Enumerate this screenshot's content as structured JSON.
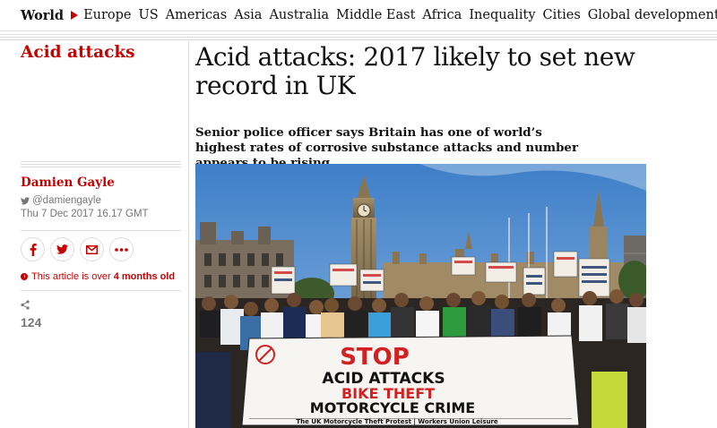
{
  "nav": {
    "active": "World",
    "items": [
      "Europe",
      "US",
      "Americas",
      "Asia",
      "Australia",
      "Middle East",
      "Africa",
      "Inequality",
      "Cities",
      "Global development"
    ]
  },
  "article": {
    "section_label": "Acid attacks",
    "headline": "Acid attacks: 2017 likely to set new record in UK",
    "standfirst": "Senior police officer says Britain has one of world’s highest rates of corrosive substance attacks and number appears to be rising",
    "author": "Damien Gayle",
    "twitter_handle": "@damiengayle",
    "date": "Thu 7 Dec 2017 16.17 GMT",
    "age_prefix": "This article is over",
    "age_value": "4 months old",
    "share_count": "124"
  },
  "photo": {
    "banner_stop": "STOP",
    "banner_line1": "ACID ATTACKS",
    "banner_line2": "BIKE THEFT",
    "banner_line3": "MOTORCYCLE CRIME",
    "banner_footer": "The UK Motorcycle Theft Protest | Workers Union Leisure"
  },
  "colors": {
    "accent": "#c70000",
    "text": "#121212",
    "muted": "#767676",
    "rule": "#dcdcdc"
  },
  "icons": {
    "twitter": "twitter-icon",
    "facebook": "facebook-icon",
    "email": "email-icon",
    "more": "more-icon",
    "clock": "clock-icon",
    "share": "share-icon"
  }
}
